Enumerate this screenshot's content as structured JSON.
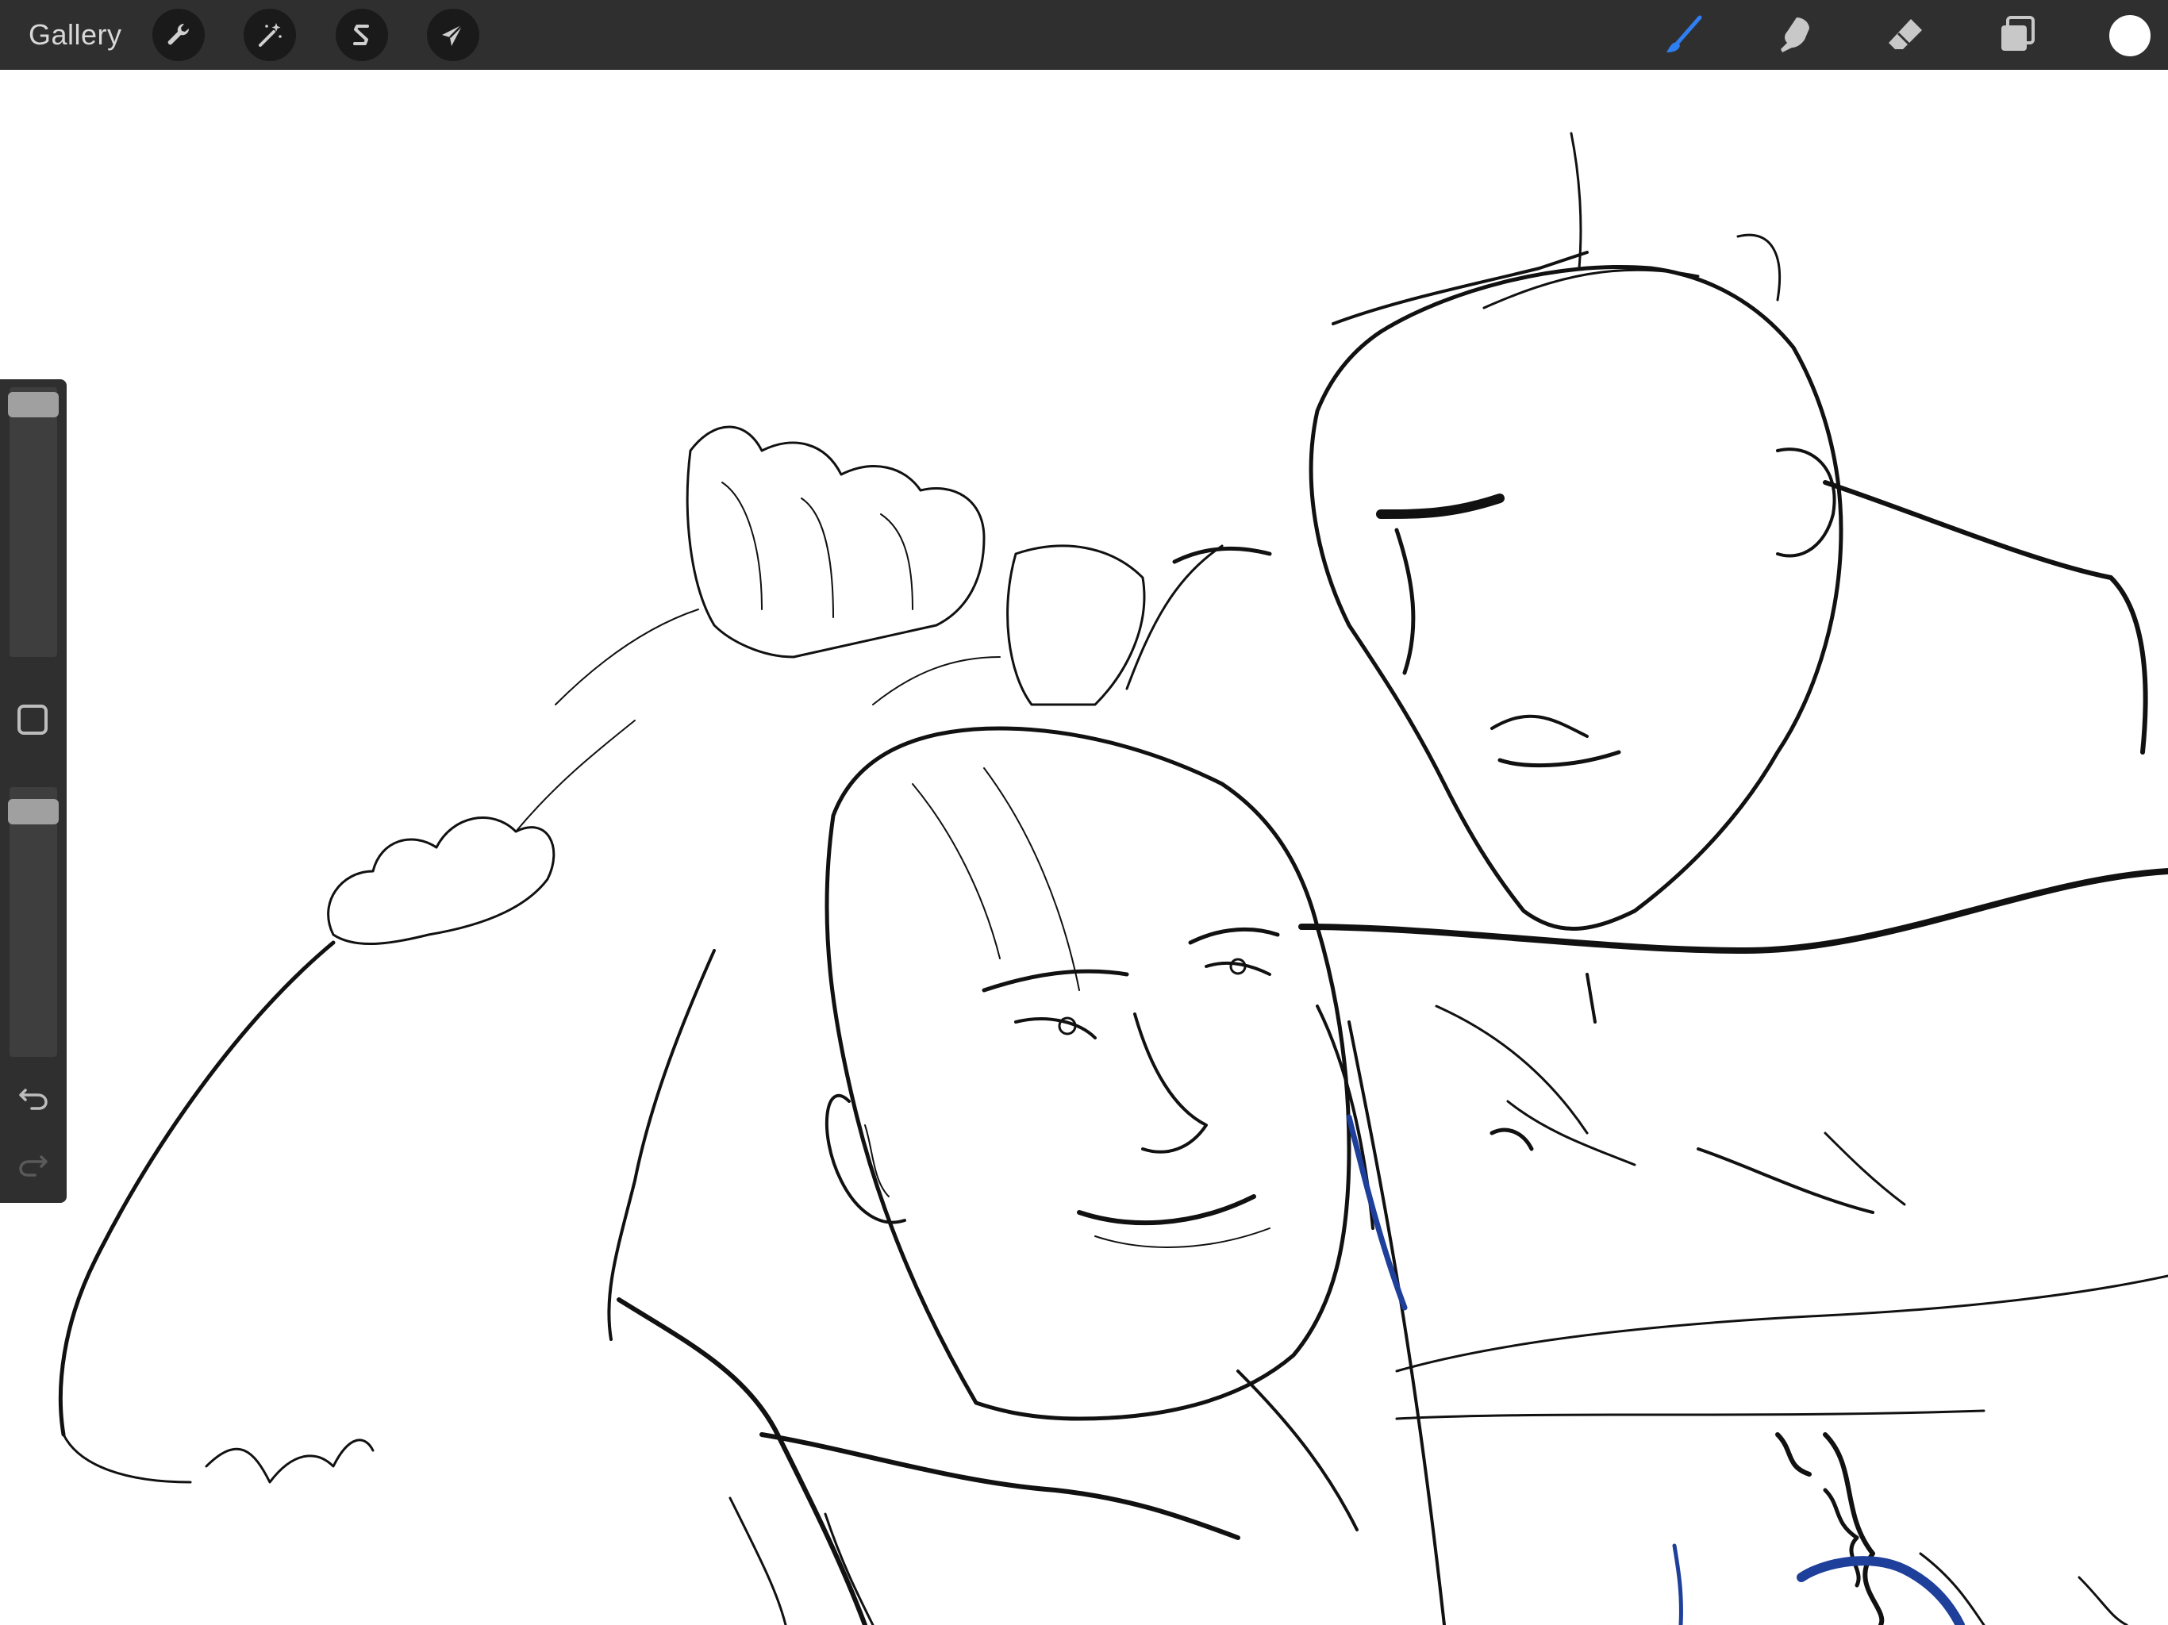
{
  "toolbar": {
    "gallery_label": "Gallery",
    "left_tools": [
      {
        "name": "actions",
        "icon": "wrench-icon"
      },
      {
        "name": "adjustments",
        "icon": "magic-wand-icon"
      },
      {
        "name": "selection",
        "icon": "selection-s-icon"
      },
      {
        "name": "transform",
        "icon": "arrow-cursor-icon"
      }
    ],
    "right_tools": [
      {
        "name": "brush",
        "icon": "brush-icon",
        "active": true,
        "color": "#2f7ff2"
      },
      {
        "name": "smudge",
        "icon": "smudge-finger-icon",
        "active": false
      },
      {
        "name": "eraser",
        "icon": "eraser-icon",
        "active": false
      },
      {
        "name": "layers",
        "icon": "layers-icon",
        "active": false
      }
    ],
    "current_color": "#ffffff"
  },
  "sidebar": {
    "brush_size_level": 0.98,
    "brush_opacity_level": 0.95,
    "modify_button_icon": "square-icon",
    "undo_icon": "undo-arrow-icon",
    "redo_icon": "redo-arrow-icon",
    "redo_enabled": false
  },
  "canvas": {
    "background": "#ffffff",
    "ink_color": "#111111",
    "accent_stroke_color": "#1e3f9a"
  }
}
